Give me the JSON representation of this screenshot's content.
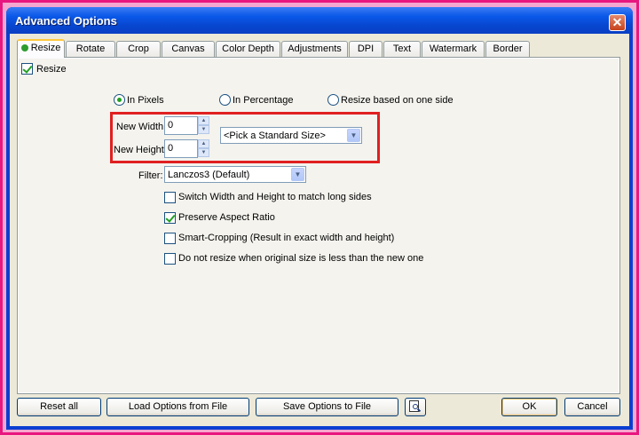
{
  "window": {
    "title": "Advanced Options",
    "close_symbol": "✕"
  },
  "tabs": [
    {
      "label": "Resize",
      "active": true
    },
    {
      "label": "Rotate"
    },
    {
      "label": "Crop"
    },
    {
      "label": "Canvas"
    },
    {
      "label": "Color Depth"
    },
    {
      "label": "Adjustments"
    },
    {
      "label": "DPI"
    },
    {
      "label": "Text"
    },
    {
      "label": "Watermark"
    },
    {
      "label": "Border"
    }
  ],
  "resize": {
    "enable_label": "Resize",
    "enable_checked": true,
    "mode_options": [
      "In Pixels",
      "In Percentage",
      "Resize based on one side"
    ],
    "mode_selected": "In Pixels",
    "width_label": "New Width:",
    "width_value": "0",
    "height_label": "New Height:",
    "height_value": "0",
    "standard_size_value": "<Pick a Standard Size>",
    "filter_label": "Filter:",
    "filter_value": "Lanczos3 (Default)",
    "options": [
      {
        "label": "Switch Width and Height to match long sides",
        "checked": false
      },
      {
        "label": "Preserve Aspect Ratio",
        "checked": true
      },
      {
        "label": "Smart-Cropping (Result in exact width and height)",
        "checked": false
      },
      {
        "label": "Do not resize when original size is less than the new one",
        "checked": false
      }
    ]
  },
  "footer": {
    "reset_label": "Reset all",
    "load_label": "Load Options from File",
    "save_label": "Save Options to File",
    "ok_label": "OK",
    "cancel_label": "Cancel"
  },
  "colors": {
    "highlight_box": "#e02020",
    "frame": "#e8177f",
    "titlebar": "#0a58e8"
  },
  "icons": {
    "preview": "preview-magnifier-icon",
    "spin_up": "▲",
    "spin_down": "▼",
    "dropdown": "▼"
  }
}
